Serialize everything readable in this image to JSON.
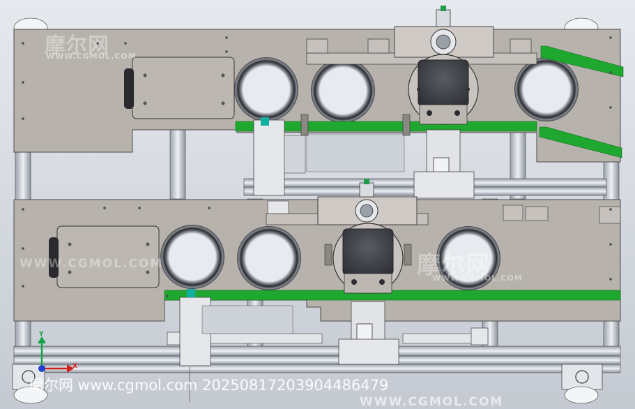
{
  "watermarks": {
    "top_left_cn": "摩尔网",
    "top_left_en": "WWW.CGMOL.COM",
    "middle_en": "WWW.CGMOL.COM",
    "right_cn": "摩尔网",
    "right_en": "WWW.CGMOL.COM",
    "bottom_en": "WWW.CGMOL.COM",
    "credit": "摩尔网 www.cgmol.com 20250817203904486479"
  },
  "triad": {
    "y_label": "Y",
    "x_label": "X"
  },
  "colors": {
    "background": "#d9dde3",
    "plate": "#b8b2ad",
    "plate_edge": "#4a4a4a",
    "rail_green": "#1fa82f",
    "frame": "#c9ced6",
    "motor_dark": "#3e3f44"
  }
}
